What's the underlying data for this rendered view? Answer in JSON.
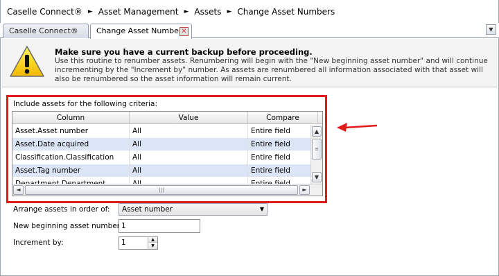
{
  "breadcrumb": [
    "Caselle Connect®",
    "Asset Management",
    "Assets",
    "Change Asset Numbers"
  ],
  "breadcrumb_separator": "►",
  "tabs": [
    {
      "label": "Caselle Connect®"
    },
    {
      "label": "Change Asset Numbers"
    }
  ],
  "tab_close_glyph": "✕",
  "tab_menu_glyph": "▼",
  "warning": {
    "icon": "warning-triangle-icon",
    "title": "Make sure you have a current backup before proceeding.",
    "body": "Use this routine to renumber assets. Renumbering will begin with the \"New beginning asset number\" and will continue incrementing by the \"Increment by\" number. As assets are renumbered all information associated with that asset will also be renumbered so the asset information will remain current."
  },
  "criteria": {
    "label": "Include assets for the following criteria:",
    "columns": [
      "Column",
      "Value",
      "Compare"
    ],
    "rows": [
      [
        "Asset.Asset number",
        "All",
        "Entire field"
      ],
      [
        "Asset.Date acquired",
        "All",
        "Entire field"
      ],
      [
        "Classification.Classification",
        "All",
        "Entire field"
      ],
      [
        "Asset.Tag number",
        "All",
        "Entire field"
      ],
      [
        "Department.Department",
        "All",
        "Entire field"
      ]
    ]
  },
  "form": {
    "arrange_label": "Arrange assets in order of:",
    "arrange_value": "Asset number",
    "new_begin_label": "New beginning asset number:",
    "new_begin_value": "1",
    "increment_label": "Increment by:",
    "increment_value": "1"
  },
  "colors": {
    "highlight_box": "#e11a1a",
    "alt_row": "#dbe5f6"
  }
}
